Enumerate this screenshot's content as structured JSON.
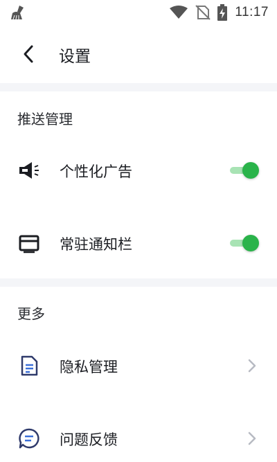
{
  "status_bar": {
    "time": "11:17",
    "icons": [
      "broom-icon",
      "wifi-icon",
      "no-sim-icon",
      "battery-charging-icon"
    ]
  },
  "header": {
    "title": "设置",
    "back_icon": "chevron-left-icon"
  },
  "sections": [
    {
      "title": "推送管理",
      "items": [
        {
          "label": "个性化广告",
          "icon": "megaphone-icon",
          "control": "toggle",
          "enabled": true
        },
        {
          "label": "常驻通知栏",
          "icon": "notification-bar-icon",
          "control": "toggle",
          "enabled": true
        }
      ]
    },
    {
      "title": "更多",
      "items": [
        {
          "label": "隐私管理",
          "icon": "document-icon",
          "control": "chevron"
        },
        {
          "label": "问题反馈",
          "icon": "chat-bubble-icon",
          "control": "chevron"
        }
      ]
    }
  ],
  "colors": {
    "toggle_on": "#2ab34a",
    "toggle_track": "#a8e3b4",
    "divider": "#f4f5f8",
    "icon_blue": "#2f3a6b",
    "chevron": "#b7bac2"
  }
}
